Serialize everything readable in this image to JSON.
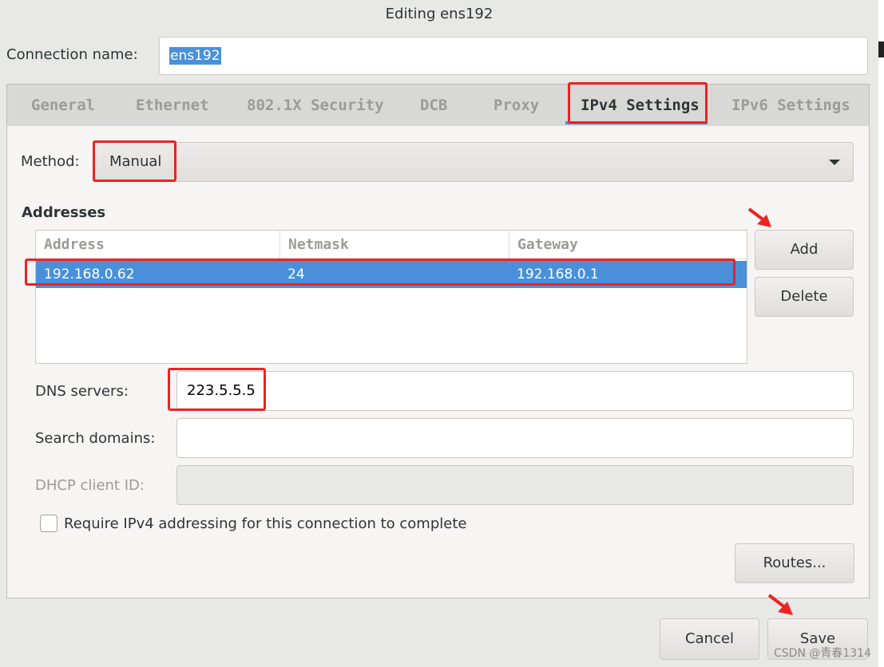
{
  "window": {
    "title": "Editing ens192"
  },
  "connection": {
    "label": "Connection name:",
    "value": "ens192"
  },
  "tabs": [
    {
      "label": "General",
      "active": false
    },
    {
      "label": "Ethernet",
      "active": false
    },
    {
      "label": "802.1X Security",
      "active": false
    },
    {
      "label": "DCB",
      "active": false
    },
    {
      "label": "Proxy",
      "active": false
    },
    {
      "label": "IPv4 Settings",
      "active": true
    },
    {
      "label": "IPv6 Settings",
      "active": false
    }
  ],
  "method": {
    "label": "Method:",
    "value": "Manual"
  },
  "addresses": {
    "heading": "Addresses",
    "columns": [
      "Address",
      "Netmask",
      "Gateway"
    ],
    "rows": [
      {
        "address": "192.168.0.62",
        "netmask": "24",
        "gateway": "192.168.0.1",
        "selected": true
      }
    ],
    "add_label": "Add",
    "delete_label": "Delete"
  },
  "dns": {
    "label": "DNS servers:",
    "value": "223.5.5.5"
  },
  "search_domains": {
    "label": "Search domains:",
    "value": ""
  },
  "dhcp_client_id": {
    "label": "DHCP client ID:",
    "value": "",
    "disabled": true
  },
  "require_ipv4": {
    "label": "Require IPv4 addressing for this connection to complete",
    "checked": false
  },
  "routes_label": "Routes...",
  "footer": {
    "cancel_label": "Cancel",
    "save_label": "Save"
  },
  "watermark": "CSDN @青春1314",
  "colors": {
    "accent": "#4a90d9",
    "highlight": "#ee2222"
  }
}
